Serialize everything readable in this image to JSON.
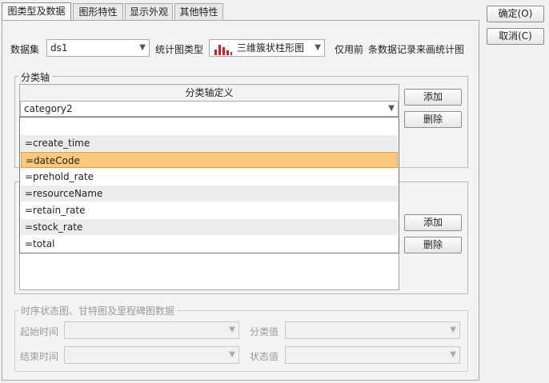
{
  "tabs": [
    "图类型及数据",
    "图形特性",
    "显示外观",
    "其他特性"
  ],
  "buttons": {
    "ok": "确定(O)",
    "cancel": "取消(C)",
    "add": "添加",
    "delete": "删除"
  },
  "top_row": {
    "dataset_label": "数据集",
    "dataset_value": "ds1",
    "chart_type_label": "统计图类型",
    "chart_type_value": "三维簇状柱形图",
    "only_first_label": "仅用前",
    "records_label": "条数据记录来画统计图"
  },
  "category_axis": {
    "group_title": "分类轴",
    "table_header": "分类轴定义",
    "combo_value": "category2",
    "options": [
      "",
      "=create_time",
      "=dateCode",
      "=prehold_rate",
      "=resourceName",
      "=retain_rate",
      "=stock_rate",
      "=total"
    ],
    "selected_option": "=dateCode"
  },
  "timing": {
    "group_title": "时序状态图、甘特图及里程碑图数据",
    "start_label": "起始时间",
    "end_label": "结束时间",
    "category_label": "分类值",
    "status_label": "状态值"
  },
  "colors": {
    "selection": "#fbc97a",
    "chart_bar": "#d81e1e"
  }
}
